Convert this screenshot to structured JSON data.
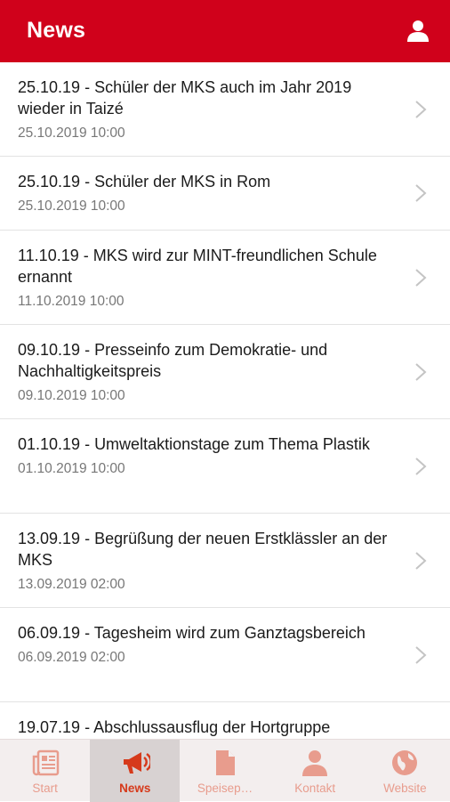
{
  "header": {
    "title": "News"
  },
  "news": [
    {
      "title": "25.10.19 - Schüler der MKS auch im Jahr 2019 wieder in Taizé",
      "date": "25.10.2019 10:00"
    },
    {
      "title": "25.10.19 - Schüler der MKS in Rom",
      "date": "25.10.2019 10:00"
    },
    {
      "title": "11.10.19 - MKS wird zur MINT-freundlichen Schule ernannt",
      "date": "11.10.2019 10:00"
    },
    {
      "title": "09.10.19 - Presseinfo zum Demokratie- und Nachhaltigkeitspreis",
      "date": "09.10.2019 10:00"
    },
    {
      "title": "01.10.19 - Umweltaktionstage zum Thema Plastik",
      "date": "01.10.2019 10:00"
    },
    {
      "title": "13.09.19 - Begrüßung der neuen Erstklässler an der MKS",
      "date": "13.09.2019 02:00"
    },
    {
      "title": "06.09.19 - Tagesheim wird zum Ganztagsbereich",
      "date": "06.09.2019 02:00"
    },
    {
      "title": "19.07.19 - Abschlussausflug der Hortgruppe",
      "date": ""
    }
  ],
  "tabs": [
    {
      "label": "Start",
      "icon": "newspaper-icon"
    },
    {
      "label": "News",
      "icon": "megaphone-icon"
    },
    {
      "label": "Speisep…",
      "icon": "document-icon"
    },
    {
      "label": "Kontakt",
      "icon": "person-icon"
    },
    {
      "label": "Website",
      "icon": "globe-icon"
    }
  ],
  "colors": {
    "brand": "#d0011b",
    "tab_inactive": "#e89c8d",
    "tab_active": "#d63a1b"
  }
}
